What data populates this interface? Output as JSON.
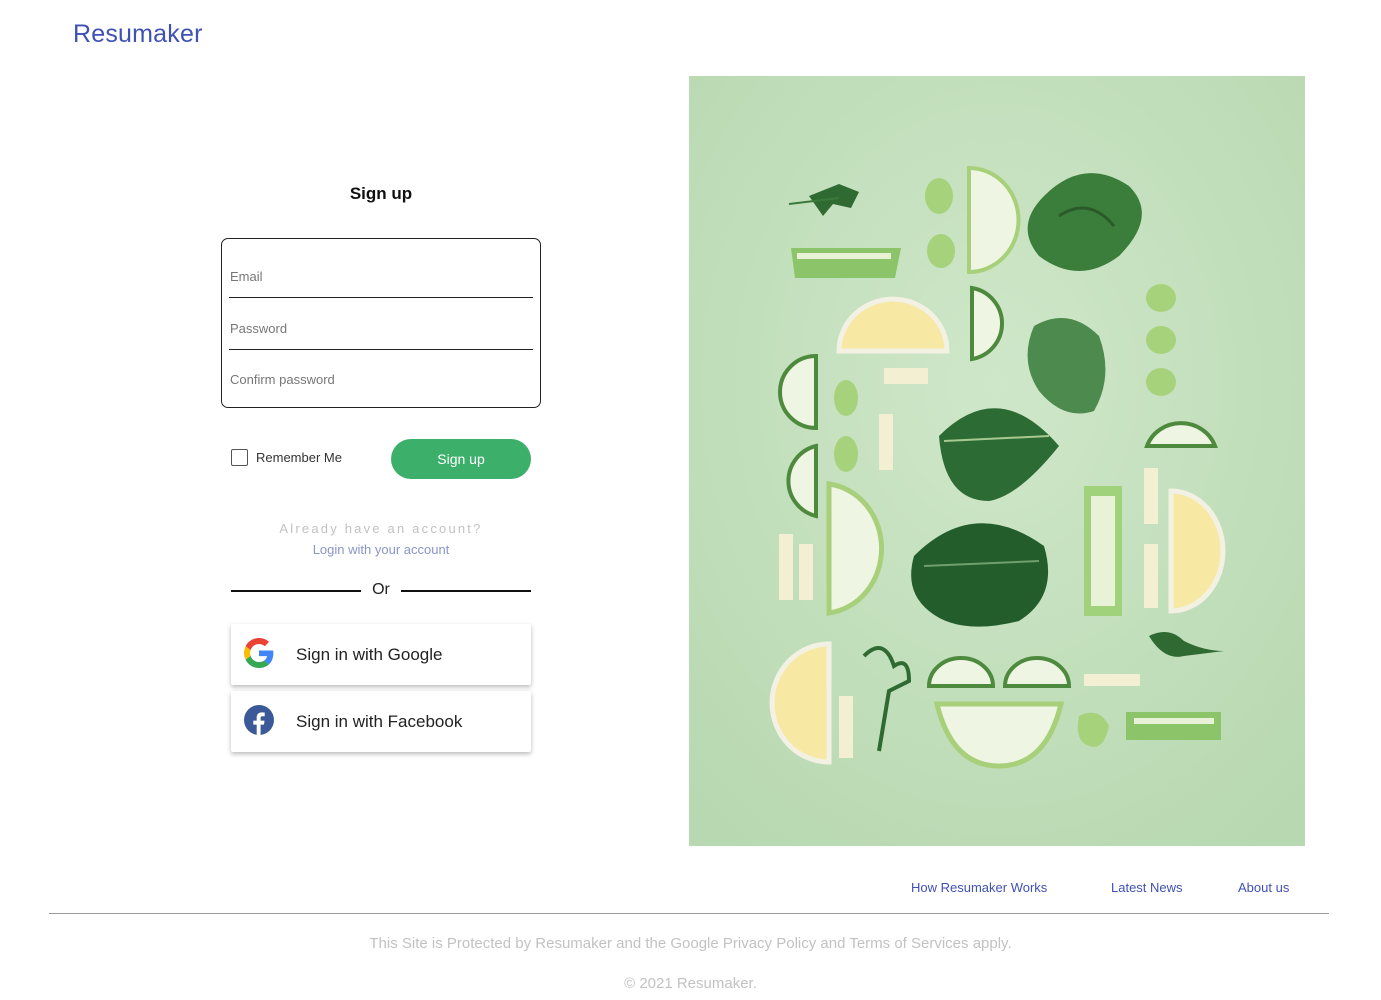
{
  "brand": {
    "name": "Resumaker",
    "color": "#3f51b5"
  },
  "form": {
    "title": "Sign up",
    "email_placeholder": "Email",
    "password_placeholder": "Password",
    "confirm_placeholder": "Confirm password",
    "remember_label": "Remember Me",
    "remember_checked": false,
    "submit_label": "Sign up",
    "submit_color": "#3cb06a",
    "already_text": "Already have an account?",
    "login_link": "Login with your account",
    "or_text": "Or"
  },
  "social": {
    "google_label": "Sign in with Google",
    "google_icon": "google-g-icon",
    "facebook_label": "Sign in with Facebook",
    "facebook_icon": "facebook-f-icon",
    "facebook_color": "#3b5998"
  },
  "hero": {
    "subject": "vegetables-flatlay-photo",
    "background": "#c6e2c1"
  },
  "footer": {
    "links": [
      "How Resumaker Works",
      "Latest News",
      "About us"
    ],
    "legal": "This Site is Protected by Resumaker and the Google Privacy Policy and Terms of Services apply.",
    "copyright": "© 2021 Resumaker."
  }
}
